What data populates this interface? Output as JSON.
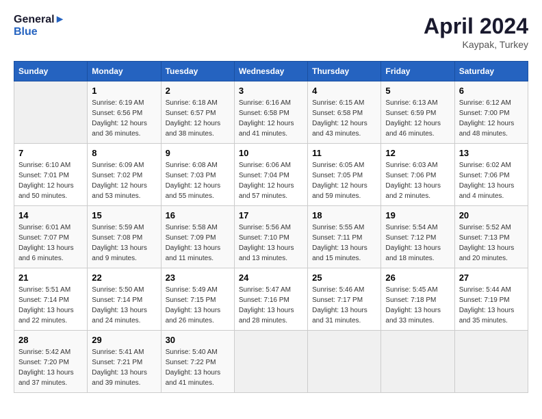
{
  "header": {
    "logo_line1": "General",
    "logo_line2": "Blue",
    "month": "April 2024",
    "location": "Kaypak, Turkey"
  },
  "columns": [
    "Sunday",
    "Monday",
    "Tuesday",
    "Wednesday",
    "Thursday",
    "Friday",
    "Saturday"
  ],
  "weeks": [
    [
      {
        "day": "",
        "sunrise": "",
        "sunset": "",
        "daylight": ""
      },
      {
        "day": "1",
        "sunrise": "Sunrise: 6:19 AM",
        "sunset": "Sunset: 6:56 PM",
        "daylight": "Daylight: 12 hours and 36 minutes."
      },
      {
        "day": "2",
        "sunrise": "Sunrise: 6:18 AM",
        "sunset": "Sunset: 6:57 PM",
        "daylight": "Daylight: 12 hours and 38 minutes."
      },
      {
        "day": "3",
        "sunrise": "Sunrise: 6:16 AM",
        "sunset": "Sunset: 6:58 PM",
        "daylight": "Daylight: 12 hours and 41 minutes."
      },
      {
        "day": "4",
        "sunrise": "Sunrise: 6:15 AM",
        "sunset": "Sunset: 6:58 PM",
        "daylight": "Daylight: 12 hours and 43 minutes."
      },
      {
        "day": "5",
        "sunrise": "Sunrise: 6:13 AM",
        "sunset": "Sunset: 6:59 PM",
        "daylight": "Daylight: 12 hours and 46 minutes."
      },
      {
        "day": "6",
        "sunrise": "Sunrise: 6:12 AM",
        "sunset": "Sunset: 7:00 PM",
        "daylight": "Daylight: 12 hours and 48 minutes."
      }
    ],
    [
      {
        "day": "7",
        "sunrise": "Sunrise: 6:10 AM",
        "sunset": "Sunset: 7:01 PM",
        "daylight": "Daylight: 12 hours and 50 minutes."
      },
      {
        "day": "8",
        "sunrise": "Sunrise: 6:09 AM",
        "sunset": "Sunset: 7:02 PM",
        "daylight": "Daylight: 12 hours and 53 minutes."
      },
      {
        "day": "9",
        "sunrise": "Sunrise: 6:08 AM",
        "sunset": "Sunset: 7:03 PM",
        "daylight": "Daylight: 12 hours and 55 minutes."
      },
      {
        "day": "10",
        "sunrise": "Sunrise: 6:06 AM",
        "sunset": "Sunset: 7:04 PM",
        "daylight": "Daylight: 12 hours and 57 minutes."
      },
      {
        "day": "11",
        "sunrise": "Sunrise: 6:05 AM",
        "sunset": "Sunset: 7:05 PM",
        "daylight": "Daylight: 12 hours and 59 minutes."
      },
      {
        "day": "12",
        "sunrise": "Sunrise: 6:03 AM",
        "sunset": "Sunset: 7:06 PM",
        "daylight": "Daylight: 13 hours and 2 minutes."
      },
      {
        "day": "13",
        "sunrise": "Sunrise: 6:02 AM",
        "sunset": "Sunset: 7:06 PM",
        "daylight": "Daylight: 13 hours and 4 minutes."
      }
    ],
    [
      {
        "day": "14",
        "sunrise": "Sunrise: 6:01 AM",
        "sunset": "Sunset: 7:07 PM",
        "daylight": "Daylight: 13 hours and 6 minutes."
      },
      {
        "day": "15",
        "sunrise": "Sunrise: 5:59 AM",
        "sunset": "Sunset: 7:08 PM",
        "daylight": "Daylight: 13 hours and 9 minutes."
      },
      {
        "day": "16",
        "sunrise": "Sunrise: 5:58 AM",
        "sunset": "Sunset: 7:09 PM",
        "daylight": "Daylight: 13 hours and 11 minutes."
      },
      {
        "day": "17",
        "sunrise": "Sunrise: 5:56 AM",
        "sunset": "Sunset: 7:10 PM",
        "daylight": "Daylight: 13 hours and 13 minutes."
      },
      {
        "day": "18",
        "sunrise": "Sunrise: 5:55 AM",
        "sunset": "Sunset: 7:11 PM",
        "daylight": "Daylight: 13 hours and 15 minutes."
      },
      {
        "day": "19",
        "sunrise": "Sunrise: 5:54 AM",
        "sunset": "Sunset: 7:12 PM",
        "daylight": "Daylight: 13 hours and 18 minutes."
      },
      {
        "day": "20",
        "sunrise": "Sunrise: 5:52 AM",
        "sunset": "Sunset: 7:13 PM",
        "daylight": "Daylight: 13 hours and 20 minutes."
      }
    ],
    [
      {
        "day": "21",
        "sunrise": "Sunrise: 5:51 AM",
        "sunset": "Sunset: 7:14 PM",
        "daylight": "Daylight: 13 hours and 22 minutes."
      },
      {
        "day": "22",
        "sunrise": "Sunrise: 5:50 AM",
        "sunset": "Sunset: 7:14 PM",
        "daylight": "Daylight: 13 hours and 24 minutes."
      },
      {
        "day": "23",
        "sunrise": "Sunrise: 5:49 AM",
        "sunset": "Sunset: 7:15 PM",
        "daylight": "Daylight: 13 hours and 26 minutes."
      },
      {
        "day": "24",
        "sunrise": "Sunrise: 5:47 AM",
        "sunset": "Sunset: 7:16 PM",
        "daylight": "Daylight: 13 hours and 28 minutes."
      },
      {
        "day": "25",
        "sunrise": "Sunrise: 5:46 AM",
        "sunset": "Sunset: 7:17 PM",
        "daylight": "Daylight: 13 hours and 31 minutes."
      },
      {
        "day": "26",
        "sunrise": "Sunrise: 5:45 AM",
        "sunset": "Sunset: 7:18 PM",
        "daylight": "Daylight: 13 hours and 33 minutes."
      },
      {
        "day": "27",
        "sunrise": "Sunrise: 5:44 AM",
        "sunset": "Sunset: 7:19 PM",
        "daylight": "Daylight: 13 hours and 35 minutes."
      }
    ],
    [
      {
        "day": "28",
        "sunrise": "Sunrise: 5:42 AM",
        "sunset": "Sunset: 7:20 PM",
        "daylight": "Daylight: 13 hours and 37 minutes."
      },
      {
        "day": "29",
        "sunrise": "Sunrise: 5:41 AM",
        "sunset": "Sunset: 7:21 PM",
        "daylight": "Daylight: 13 hours and 39 minutes."
      },
      {
        "day": "30",
        "sunrise": "Sunrise: 5:40 AM",
        "sunset": "Sunset: 7:22 PM",
        "daylight": "Daylight: 13 hours and 41 minutes."
      },
      {
        "day": "",
        "sunrise": "",
        "sunset": "",
        "daylight": ""
      },
      {
        "day": "",
        "sunrise": "",
        "sunset": "",
        "daylight": ""
      },
      {
        "day": "",
        "sunrise": "",
        "sunset": "",
        "daylight": ""
      },
      {
        "day": "",
        "sunrise": "",
        "sunset": "",
        "daylight": ""
      }
    ]
  ]
}
